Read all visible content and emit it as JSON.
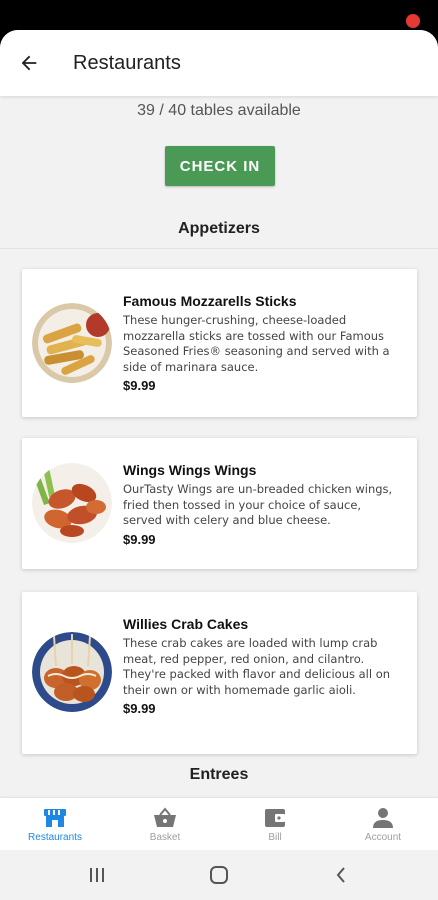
{
  "header": {
    "title": "Restaurants",
    "back_icon": "arrow-left-icon"
  },
  "availability": {
    "text": "39 / 40 tables available"
  },
  "check_in": {
    "label": "CHECK IN",
    "color": "#4a9a56"
  },
  "sections": [
    {
      "title": "Appetizers"
    },
    {
      "title": "Entrees"
    }
  ],
  "items": [
    {
      "name": "Famous Mozzarells Sticks",
      "description": "These hunger-crushing, cheese-loaded mozzarella sticks are tossed with our Famous Seasoned Fries® seasoning and served with a side of marinara sauce.",
      "price": "$9.99"
    },
    {
      "name": "Wings Wings Wings",
      "description": "OurTasty Wings are un-breaded chicken wings, fried then tossed in your choice of sauce, served with celery and blue cheese.",
      "price": "$9.99"
    },
    {
      "name": "Willies Crab Cakes",
      "description": "These crab cakes are loaded with lump crab meat, red pepper, red onion, and cilantro. They're packed with flavor and delicious all on their own or with homemade garlic aioli.",
      "price": "$9.99"
    }
  ],
  "bottom_nav": [
    {
      "label": "Restaurants",
      "icon": "storefront-icon",
      "active": true
    },
    {
      "label": "Basket",
      "icon": "basket-icon",
      "active": false
    },
    {
      "label": "Bill",
      "icon": "wallet-icon",
      "active": false
    },
    {
      "label": "Account",
      "icon": "person-icon",
      "active": false
    }
  ],
  "colors": {
    "accent": "#1e88e5",
    "inactive": "#9e9e9e",
    "button": "#4a9a56"
  }
}
